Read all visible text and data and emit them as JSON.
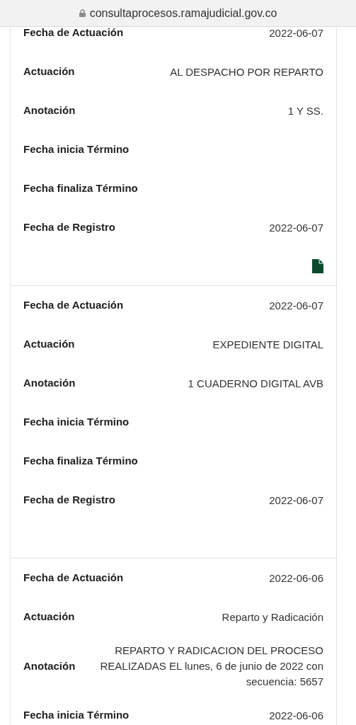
{
  "address_bar": {
    "url": "consultaprocesos.ramajudicial.gov.co",
    "secure": true
  },
  "records": [
    {
      "has_document": true,
      "fields": [
        {
          "label": "Fecha de Actuación",
          "value": "2022-06-07"
        },
        {
          "label": "Actuación",
          "value": "AL DESPACHO POR REPARTO"
        },
        {
          "label": "Anotación",
          "value": "1 Y SS."
        },
        {
          "label": "Fecha inicia Término"
        },
        {
          "label": "Fecha finaliza Término"
        },
        {
          "label": "Fecha de Registro",
          "value": "2022-06-07"
        }
      ]
    },
    {
      "has_document": false,
      "fields": [
        {
          "label": "Fecha de Actuación",
          "value": "2022-06-07"
        },
        {
          "label": "Actuación",
          "value": "EXPEDIENTE DIGITAL"
        },
        {
          "label": "Anotación",
          "value": "1 CUADERNO DIGITAL AVB"
        },
        {
          "label": "Fecha inicia Término"
        },
        {
          "label": "Fecha finaliza Término"
        },
        {
          "label": "Fecha de Registro",
          "value": "2022-06-07"
        }
      ]
    },
    {
      "fields": [
        {
          "label": "Fecha de Actuación",
          "value": "2022-06-06"
        },
        {
          "label": "Actuación",
          "value": "Reparto y Radicación"
        },
        {
          "label": "Anotación",
          "value": "REPARTO Y RADICACION DEL PROCESO REALIZADAS EL lunes, 6 de junio de 2022 con secuencia: 5657"
        },
        {
          "label": "Fecha inicia Término",
          "value": "2022-06-06"
        }
      ]
    }
  ]
}
